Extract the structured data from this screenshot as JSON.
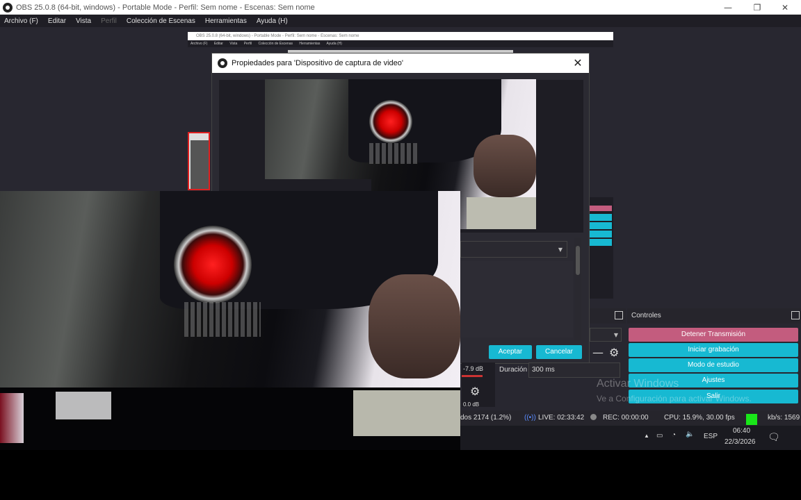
{
  "window": {
    "title": "OBS 25.0.8 (64-bit, windows) - Portable Mode - Perfil: Sem nome - Escenas: Sem nome",
    "minimize": "—",
    "restore": "❐",
    "close": "✕"
  },
  "menu": {
    "items": [
      "Archivo (F)",
      "Editar",
      "Vista",
      "Perfil",
      "Colección de Escenas",
      "Herramientas",
      "Ayuda (H)"
    ],
    "disabled_index": 3
  },
  "dialog": {
    "title": "Propiedades para 'Dispositivo de captura de video'",
    "close_icon": "✕",
    "accept_label": "Aceptar",
    "cancel_label": "Cancelar"
  },
  "controls": {
    "header": "Controles",
    "buttons": [
      "Detener Transmisión",
      "Iniciar grabación",
      "Modo de estudio",
      "Ajustes",
      "Salir"
    ]
  },
  "transitions": {
    "minus": "—",
    "duration_label": "Duración",
    "duration_value": "300 ms"
  },
  "mixer": {
    "db1": "-7.9 dB",
    "db2": "0.0 dB"
  },
  "watermark": {
    "line1": "Activar Windows",
    "line2": "Ve a Configuración para activar Windows."
  },
  "status": {
    "dropped": "dos 2174 (1.2%)",
    "live": "LIVE: 02:33:42",
    "rec": "REC: 00:00:00",
    "cpu": "CPU: 15.9%, 30.00 fps",
    "kbps": "kb/s: 1569"
  },
  "taskbar": {
    "lang": "ESP",
    "time": "06:40",
    "date": "22/3/2026"
  },
  "colors": {
    "accent_cyan": "#17b9d2",
    "accent_pink": "#c35c7e",
    "panel_bg": "#282730",
    "status_green": "#19e619"
  }
}
